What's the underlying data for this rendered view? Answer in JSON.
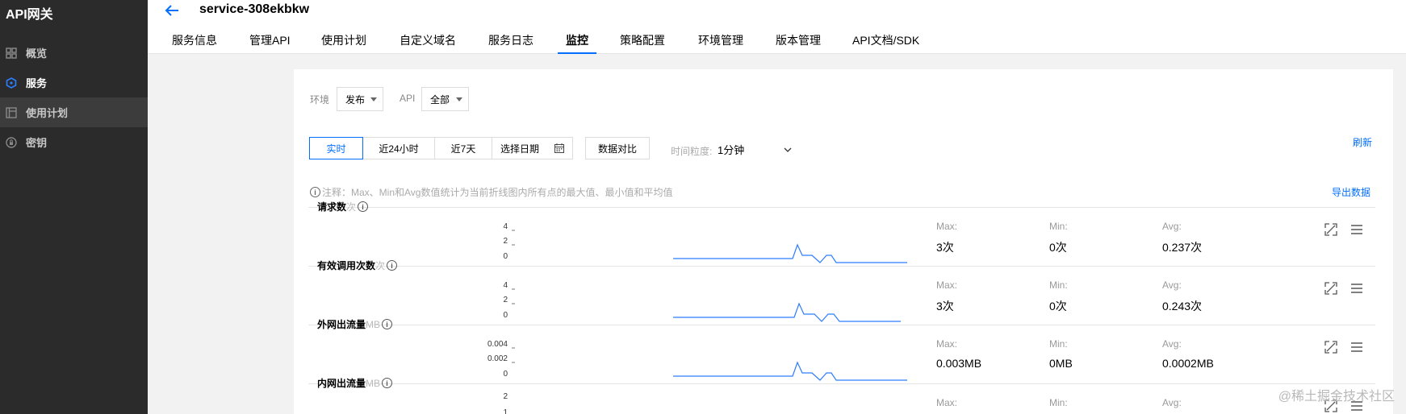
{
  "sidebar": {
    "brand": "API网关",
    "items": [
      {
        "label": "概览",
        "icon": "grid-icon"
      },
      {
        "label": "服务",
        "icon": "hexagon-icon"
      },
      {
        "label": "使用计划",
        "icon": "plan-icon"
      },
      {
        "label": "密钥",
        "icon": "key-icon"
      }
    ]
  },
  "header": {
    "service_name": "service-308ekbkw",
    "tabs": [
      "服务信息",
      "管理API",
      "使用计划",
      "自定义域名",
      "服务日志",
      "监控",
      "策略配置",
      "环境管理",
      "版本管理",
      "API文档/SDK"
    ],
    "active_tab": "监控"
  },
  "filters": {
    "env_label": "环境",
    "env_value": "发布",
    "api_label": "API",
    "api_value": "全部"
  },
  "time": {
    "ranges": [
      "实时",
      "近24小时",
      "近7天"
    ],
    "date_picker": "选择日期",
    "compare": "数据对比",
    "granularity_label": "时间粒度:",
    "granularity_value": "1分钟",
    "refresh": "刷新"
  },
  "note": {
    "text": "注释：Max、Min和Avg数值统计为当前折线图内所有点的最大值、最小值和平均值",
    "export": "导出数据"
  },
  "metrics": [
    {
      "title": "请求数",
      "unit": "次",
      "ticks": [
        "4",
        "2",
        "0"
      ],
      "max_label": "Max:",
      "max": "3次",
      "min_label": "Min:",
      "min": "0次",
      "avg_label": "Avg:",
      "avg": "0.237次"
    },
    {
      "title": "有效调用次数",
      "unit": "次",
      "ticks": [
        "4",
        "2",
        "0"
      ],
      "max_label": "Max:",
      "max": "3次",
      "min_label": "Min:",
      "min": "0次",
      "avg_label": "Avg:",
      "avg": "0.243次"
    },
    {
      "title": "外网出流量",
      "unit": "MB",
      "ticks": [
        "0.004",
        "0.002",
        "0"
      ],
      "max_label": "Max:",
      "max": "0.003MB",
      "min_label": "Min:",
      "min": "0MB",
      "avg_label": "Avg:",
      "avg": "0.0002MB"
    },
    {
      "title": "内网出流量",
      "unit": "MB",
      "ticks": [
        "2",
        "1"
      ],
      "max_label": "Max:",
      "min_label": "Min:",
      "avg_label": "Avg:"
    }
  ],
  "watermark": "@稀土掘金技术社区",
  "colors": {
    "accent": "#006eff",
    "sidebar": "#2b2b2b"
  }
}
